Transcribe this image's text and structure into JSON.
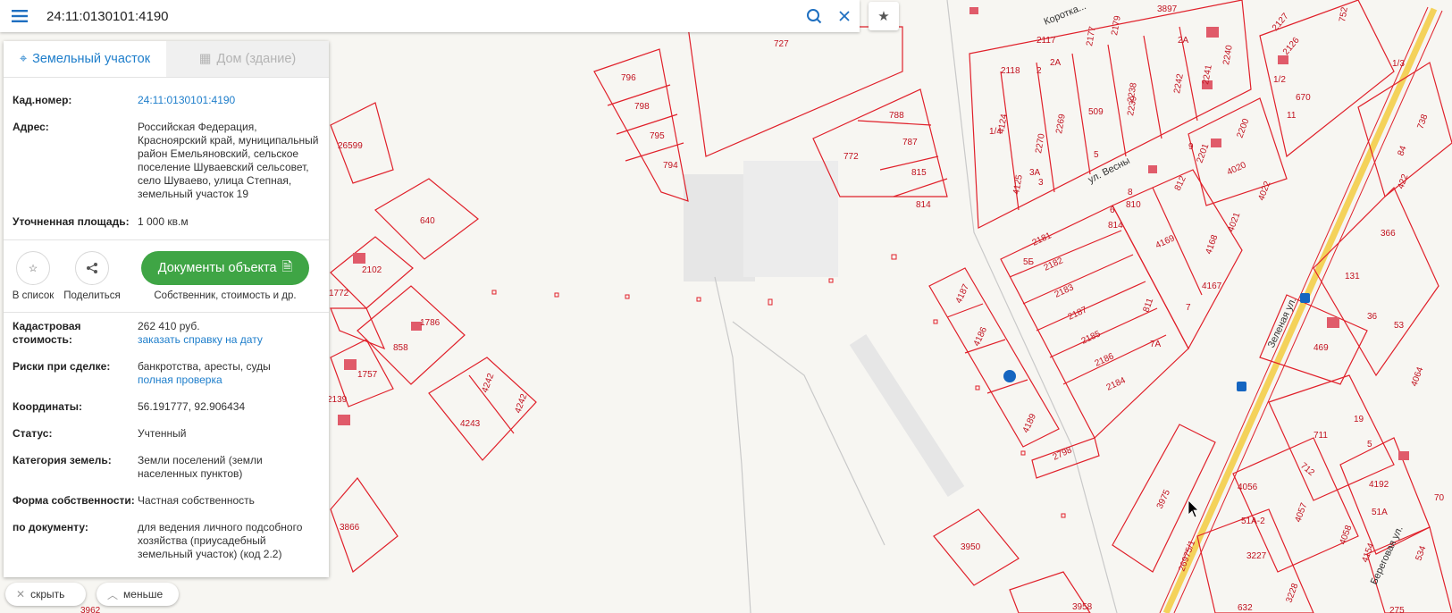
{
  "search": {
    "value": "24:11:0130101:4190"
  },
  "tabs": [
    {
      "label": "Земельный участок"
    },
    {
      "label": "Дом (здание)"
    }
  ],
  "info": {
    "kad_label": "Кад.номер:",
    "kad_value": "24:11:0130101:4190",
    "address_label": "Адрес:",
    "address_value": "Российская Федерация, Красноярский край, муниципальный район Емельяновский, сельское поселение Шуваевский сельсовет, село Шуваево, улица Степная, земельный участок 19",
    "area_label": "Уточненная площадь:",
    "area_value": "1 000 кв.м"
  },
  "actions": {
    "to_list": "В список",
    "share": "Поделиться",
    "docs_button": "Документы объекта",
    "docs_sub": "Собственник, стоимость и др."
  },
  "details": {
    "cost_label": "Кадастровая стоимость:",
    "cost_value": "262 410 руб.",
    "cost_link": "заказать справку на дату",
    "risk_label": "Риски при сделке:",
    "risk_value": "банкротства, аресты, суды",
    "risk_link": "полная проверка",
    "coords_label": "Координаты:",
    "coords_value": "56.191777, 92.906434",
    "status_label": "Статус:",
    "status_value": "Учтенный",
    "category_label": "Категория земель:",
    "category_value": "Земли поселений (земли населенных пунктов)",
    "ownership_label": "Форма собственности:",
    "ownership_value": "Частная собственность",
    "doc_label": "по документу:",
    "doc_value": "для ведения личного подсобного хозяйства (приусадебный земельный участок) (код 2.2)"
  },
  "bottom": {
    "hide": "скрыть",
    "less": "меньше"
  },
  "map": {
    "plot_labels": [
      "727",
      "796",
      "798",
      "795",
      "794",
      "788",
      "787",
      "772",
      "815",
      "814",
      "26599",
      "640",
      "2102",
      "1772",
      "1786",
      "858",
      "1757",
      "2139",
      "4242",
      "4242",
      "4243",
      "3866",
      "3962",
      "4187",
      "4186",
      "4189",
      "2798",
      "3950",
      "3975",
      "3958",
      "2181",
      "2182",
      "2183",
      "2187",
      "2185",
      "2186",
      "2184",
      "811",
      "4169",
      "4168",
      "4167",
      "7",
      "814",
      "810",
      "812",
      "4021",
      "4022",
      "4020",
      "2201",
      "2200",
      "4124",
      "4125",
      "2270",
      "2269",
      "509",
      "5",
      "2118",
      "2117",
      "2177",
      "2179",
      "2238",
      "2239",
      "2242",
      "2241",
      "2240",
      "3897",
      "2127",
      "2126",
      "670",
      "11",
      "752",
      "738",
      "84",
      "422",
      "366",
      "131",
      "36",
      "469",
      "19",
      "711",
      "712",
      "4192",
      "4056",
      "4057",
      "4058",
      "4154",
      "3227",
      "3228",
      "632",
      "70",
      "534",
      "4064",
      "5",
      "3",
      "3А",
      "9",
      "8",
      "6",
      "1/4",
      "2",
      "2А",
      "1/3",
      "1/2",
      "7А",
      "5Б",
      "51А",
      "51А-2",
      "53",
      "2А",
      "26975/1",
      "275"
    ],
    "streets": [
      "Коротка...",
      "ул. Весны",
      "Зеленая ул.",
      "Береговая ул."
    ],
    "accent": "#e0202a",
    "marker_color": "#1565c0"
  }
}
